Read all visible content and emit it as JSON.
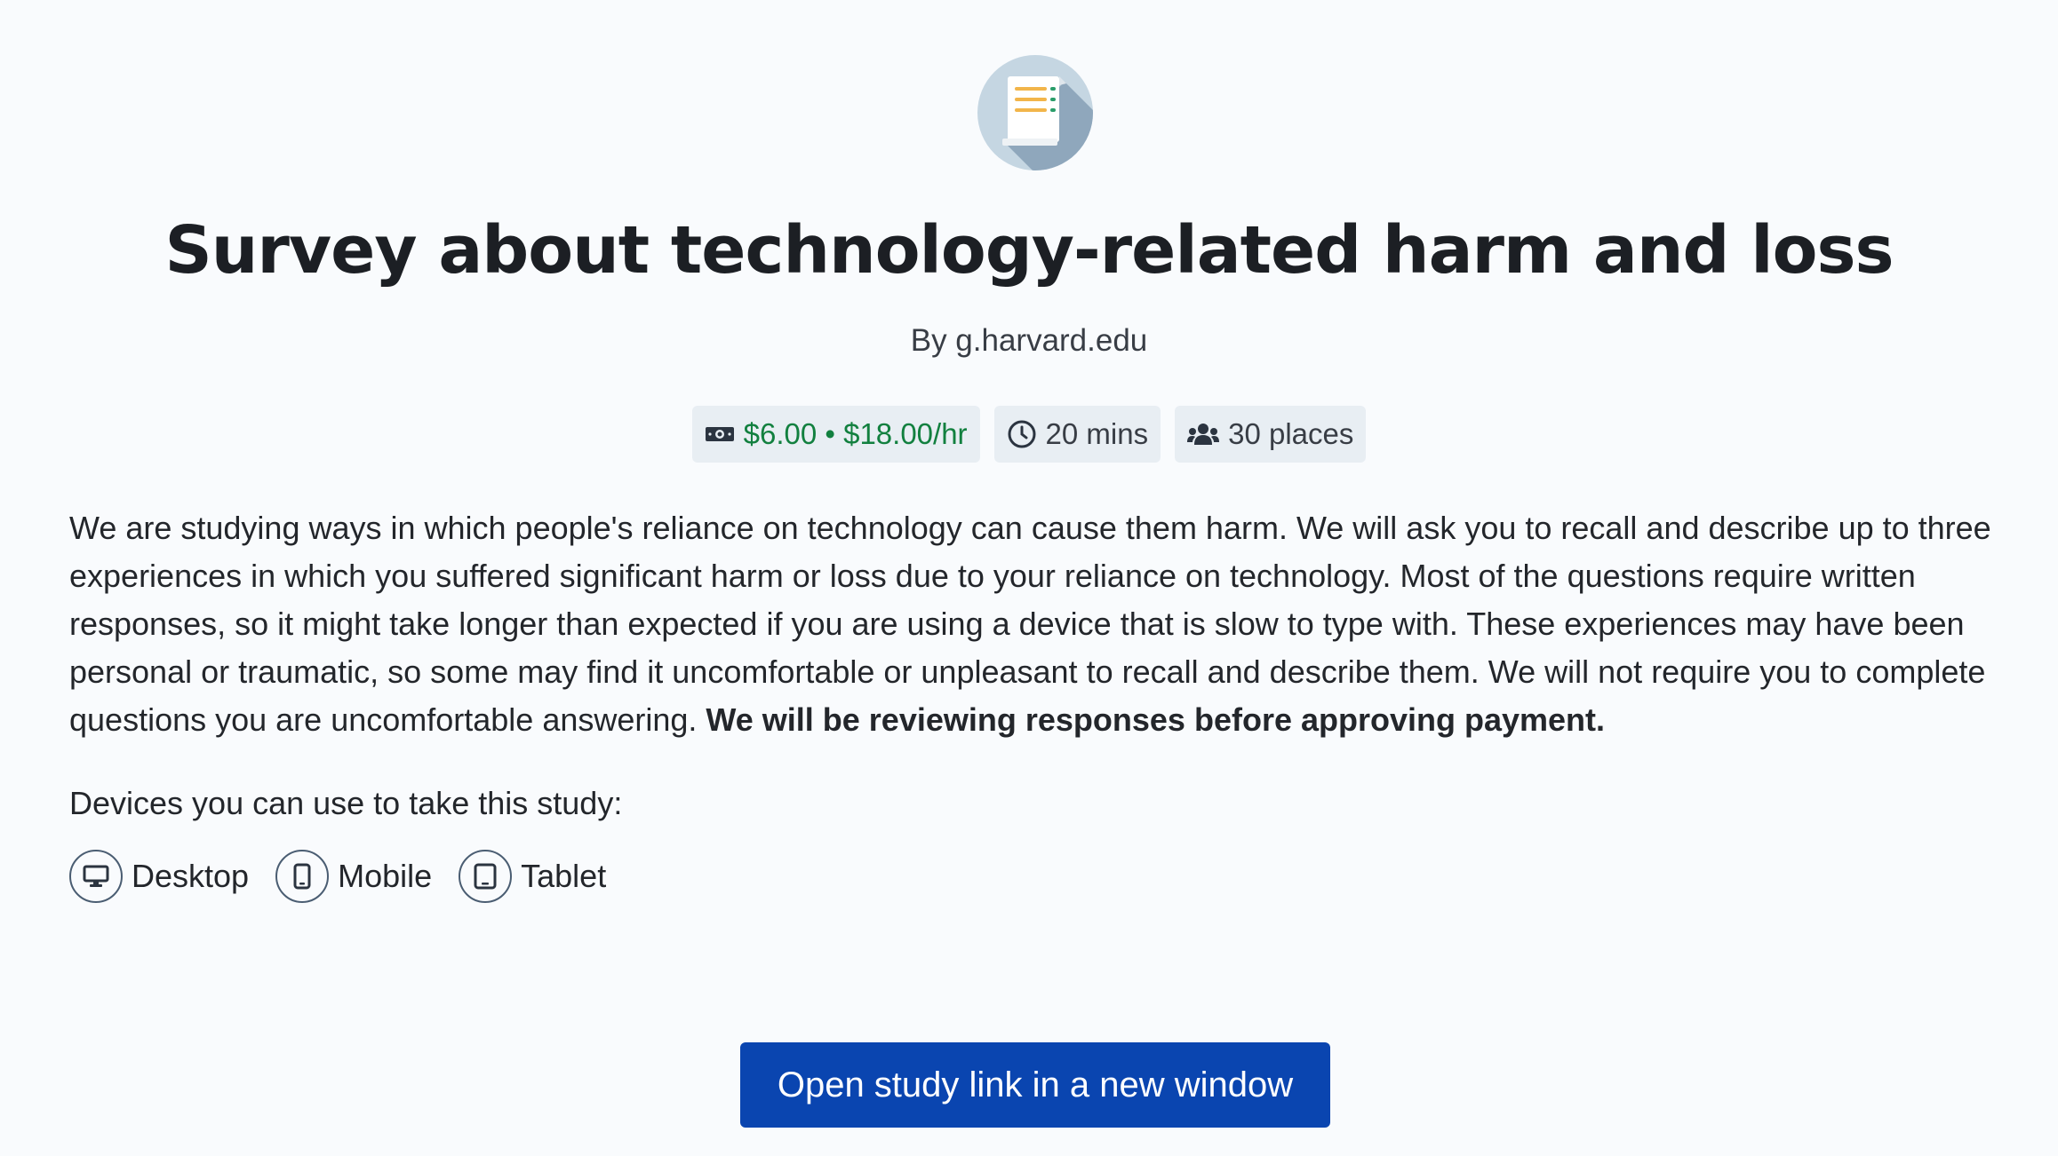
{
  "study": {
    "title": "Survey about technology-related harm and loss",
    "author": "By g.harvard.edu",
    "icon": "scroll-document-icon"
  },
  "stats": {
    "reward": "$6.00 • $18.00/hr",
    "duration": "20 mins",
    "places": "30 places"
  },
  "description": {
    "text": "We are studying ways in which people's reliance on technology can cause them harm. We will ask you to recall and describe up to three experiences in which you suffered significant harm or loss due to your reliance on technology. Most of the questions require written responses, so it might take longer than expected if you are using a device that is slow to type with.  These experiences may have been personal or traumatic, so some may find it uncomfortable or unpleasant to recall and describe them. We will not require you to complete questions you are uncomfortable answering. ",
    "bold_text": "We will be reviewing responses before approving payment."
  },
  "devices": {
    "heading": "Devices you can use to take this study:",
    "items": [
      {
        "label": "Desktop",
        "icon": "desktop-icon"
      },
      {
        "label": "Mobile",
        "icon": "mobile-icon"
      },
      {
        "label": "Tablet",
        "icon": "tablet-icon"
      }
    ]
  },
  "actions": {
    "open_study_label": "Open study link in a new window"
  },
  "colors": {
    "background": "#f9fbfd",
    "reward_green": "#12803f",
    "chip_bg": "#e8eef3",
    "primary_button": "#0a45b0"
  }
}
